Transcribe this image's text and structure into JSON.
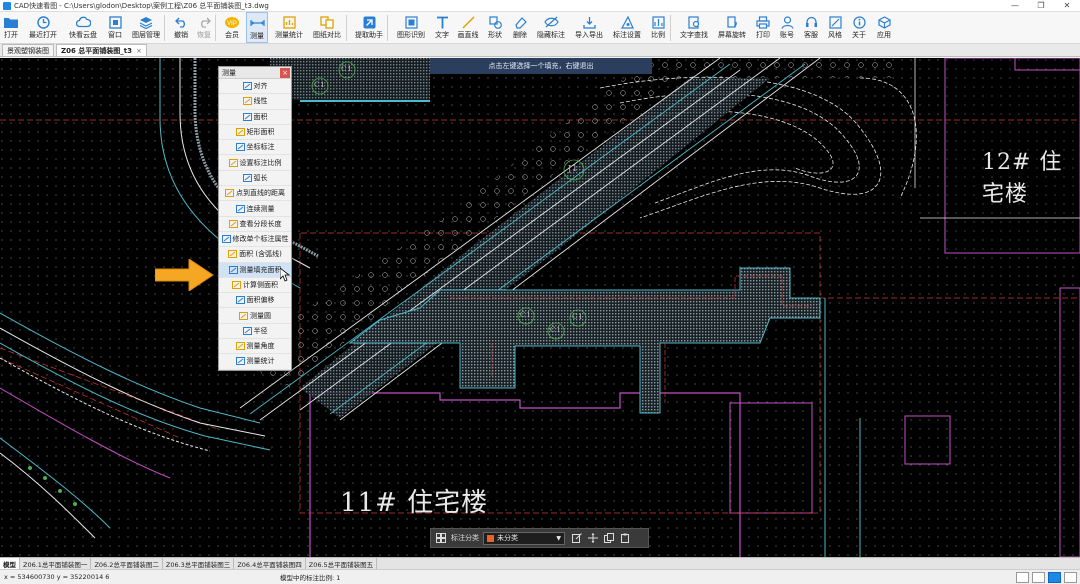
{
  "window": {
    "title": "CAD快速看图 - C:\\Users\\glodon\\Desktop\\案例工程\\Z06 总平面铺装图_t3.dwg",
    "controls": [
      "—",
      "❐",
      "✕"
    ]
  },
  "toolbar": {
    "items": [
      {
        "label": "打开",
        "icon": "folder-icon"
      },
      {
        "label": "最近打开",
        "icon": "clock-icon"
      },
      {
        "label": "快看云盘",
        "icon": "cloud-icon"
      },
      {
        "label": "窗口",
        "icon": "window-icon"
      },
      {
        "label": "图层管理",
        "icon": "layers-icon"
      },
      {
        "label": "撤销",
        "icon": "undo-icon"
      },
      {
        "label": "恢复",
        "icon": "redo-icon"
      },
      {
        "label": "会员",
        "icon": "vip-icon"
      },
      {
        "label": "测量",
        "icon": "measure-icon"
      },
      {
        "label": "测量统计",
        "icon": "measure-stats-icon"
      },
      {
        "label": "图纸对比",
        "icon": "compare-icon"
      },
      {
        "label": "提取助手",
        "icon": "extract-icon"
      },
      {
        "label": "图形识别",
        "icon": "recognize-icon"
      },
      {
        "label": "文字",
        "icon": "text-icon"
      },
      {
        "label": "画直线",
        "icon": "line-icon"
      },
      {
        "label": "形状",
        "icon": "shape-icon"
      },
      {
        "label": "删除",
        "icon": "eraser-icon"
      },
      {
        "label": "隐藏标注",
        "icon": "hide-icon"
      },
      {
        "label": "导入导出",
        "icon": "import-export-icon"
      },
      {
        "label": "标注设置",
        "icon": "annotation-settings-icon"
      },
      {
        "label": "比例",
        "icon": "scale-icon"
      },
      {
        "label": "文字查找",
        "icon": "text-search-icon"
      },
      {
        "label": "屏幕旋转",
        "icon": "rotate-icon"
      },
      {
        "label": "打印",
        "icon": "print-icon"
      },
      {
        "label": "账号",
        "icon": "user-icon"
      },
      {
        "label": "客服",
        "icon": "headset-icon"
      },
      {
        "label": "风格",
        "icon": "style-icon"
      },
      {
        "label": "关于",
        "icon": "info-icon"
      },
      {
        "label": "应用",
        "icon": "apps-icon"
      }
    ],
    "active": "测量"
  },
  "doc_tabs": [
    {
      "label": "景观塑钢装图",
      "active": false
    },
    {
      "label": "Z06 总平面铺装图_t3",
      "active": true
    }
  ],
  "canvas": {
    "hint": "点击左键选择一个填充，右键退出",
    "labels": {
      "building_11": "11# 住宅楼",
      "building_12": "12# 住宅楼",
      "marker_j1": "J1",
      "marker_c1a": "C1",
      "marker_c1b": "C1",
      "marker_c1c": "C1",
      "marker_c1d": "C1",
      "marker_c1e": "C1"
    }
  },
  "measure_menu": {
    "title": "测量",
    "close": "×",
    "items": [
      {
        "label": "对齐",
        "icon": "align-icon"
      },
      {
        "label": "线性",
        "icon": "linear-icon"
      },
      {
        "label": "面积",
        "icon": "area-icon"
      },
      {
        "label": "矩形面积",
        "icon": "rect-area-icon"
      },
      {
        "label": "坐标标注",
        "icon": "coordinate-icon"
      },
      {
        "label": "设置标注比例",
        "icon": "set-scale-icon"
      },
      {
        "label": "弧长",
        "icon": "arc-length-icon"
      },
      {
        "label": "点到直线的距离",
        "icon": "point-line-distance-icon"
      },
      {
        "label": "连续测量",
        "icon": "continuous-measure-icon"
      },
      {
        "label": "查看分段长度",
        "icon": "segment-length-icon"
      },
      {
        "label": "修改单个标注属性",
        "icon": "edit-annotation-icon"
      },
      {
        "label": "面积 (含弧线)",
        "icon": "arc-area-icon"
      },
      {
        "label": "测量填充面积",
        "icon": "fill-area-icon"
      },
      {
        "label": "计算侧面积",
        "icon": "side-area-icon"
      },
      {
        "label": "面积偏移",
        "icon": "area-offset-icon"
      },
      {
        "label": "测量圆",
        "icon": "circle-icon"
      },
      {
        "label": "半径",
        "icon": "radius-icon"
      },
      {
        "label": "测量角度",
        "icon": "angle-icon"
      },
      {
        "label": "测量统计",
        "icon": "stats-icon"
      }
    ],
    "highlighted": "测量填充面积"
  },
  "float_toolbar": {
    "label": "标注分类",
    "category": "未分类",
    "category_color": "#e8632a",
    "icons": [
      "grid-icon",
      "edit-icon",
      "move-icon",
      "copy-icon",
      "paste-icon"
    ]
  },
  "layout_tabs": [
    {
      "label": "模型",
      "active": true
    },
    {
      "label": "Z06.1总平面铺装图一",
      "active": false
    },
    {
      "label": "Z06.2总平面铺装图二",
      "active": false
    },
    {
      "label": "Z06.3总平面铺装图三",
      "active": false
    },
    {
      "label": "Z06.4总平面铺装图四",
      "active": false
    },
    {
      "label": "Z06.5总平面铺装图五",
      "active": false
    }
  ],
  "status": {
    "coords": "x = 534600730  y = 35220014 6",
    "scale_text": "模型中的标注比例: 1"
  },
  "colors": {
    "canvas_bg": "#000000",
    "hint_bg": "#2c3e5e",
    "accent_arrow": "#f5a623",
    "cad_cyan": "#4fb8c9",
    "cad_magenta": "#c24fc7",
    "cad_red": "#d33a3a",
    "cad_green": "#4caf50",
    "cad_white": "#e8e8e8",
    "cad_hatch": "#7c8f9a"
  }
}
